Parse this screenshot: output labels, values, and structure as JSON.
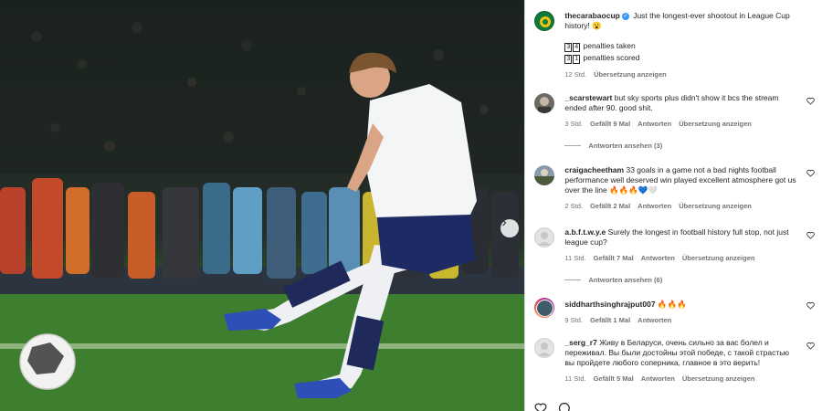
{
  "post": {
    "username": "thecarabaocup",
    "caption": "Just the longest-ever shootout in League Cup history! 😮",
    "stat1_digits": [
      "3",
      "4"
    ],
    "stat1_text": "penalties taken",
    "stat2_digits": [
      "3",
      "1"
    ],
    "stat2_text": "penalties scored",
    "time": "12 Std.",
    "translate": "Übersetzung anzeigen"
  },
  "comments": [
    {
      "username": "_scarstewart",
      "text": "but sky sports plus didn't show it bcs the stream ended after 90. good shit.",
      "time": "3 Std.",
      "likes": "Gefällt 9 Mal",
      "reply": "Antworten",
      "translate": "Übersetzung anzeigen",
      "view_replies": "Antworten ansehen (3)"
    },
    {
      "username": "craigacheetham",
      "text": "33 goals in a game not a bad nights football performance well deserved win played excellent atmosphere got us over the line 🔥🔥🔥💙🤍",
      "time": "2 Std.",
      "likes": "Gefällt 2 Mal",
      "reply": "Antworten",
      "translate": "Übersetzung anzeigen"
    },
    {
      "username": "a.b.f.t.w.y.e",
      "text": "Surely the longest in football history full stop, not just league cup?",
      "time": "11 Std.",
      "likes": "Gefällt 7 Mal",
      "reply": "Antworten",
      "translate": "Übersetzung anzeigen",
      "view_replies": "Antworten ansehen (6)"
    },
    {
      "username": "siddharthsinghrajput007",
      "text": "🔥🔥🔥",
      "time": "9 Std.",
      "likes": "Gefällt 1 Mal",
      "reply": "Antworten"
    },
    {
      "username": "_serg_r7",
      "text": "Живу в Беларуси, очень сильно за вас болел и переживал. Вы были достойны этой победе, с такой страстью вы пройдете любого соперника, главное в это верить!",
      "time": "11 Std.",
      "likes": "Gefällt 5 Mal",
      "reply": "Antworten",
      "translate": "Übersetzung anzeigen"
    }
  ],
  "colors": {
    "carabao_green": "#0f7a3c",
    "link_gray": "#737373",
    "verified_blue": "#3897f0"
  },
  "icons": [
    "carabao-logo-icon",
    "verified-icon",
    "heart-icon",
    "next-arrow-icon",
    "like-icon",
    "comment-icon"
  ]
}
